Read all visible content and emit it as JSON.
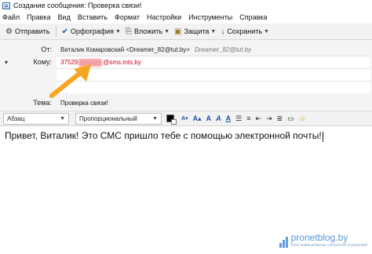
{
  "window": {
    "title": "Создание сообщения: Проверка связи!"
  },
  "menu": {
    "items": [
      "Файл",
      "Правка",
      "Вид",
      "Вставить",
      "Формат",
      "Настройки",
      "Инструменты",
      "Справка"
    ]
  },
  "toolbar": {
    "send": "Отправить",
    "spelling": "Орфография",
    "attach": "Вложить",
    "security": "Защита",
    "save": "Сохранить"
  },
  "headers": {
    "from_label": "От:",
    "from_name": "Виталик Комаровский <Dreamer_82@tut.by>",
    "from_alt": "Dreamer_82@tut.by",
    "to_label": "Кому:",
    "to_prefix": "37529",
    "to_suffix": "@sms.mts.by",
    "subject_label": "Тема:",
    "subject": "Проверка связи!"
  },
  "format": {
    "paragraph": "Абзац",
    "font": "Пропорциональный",
    "text_color": "#000000",
    "background_color": "#ffffff"
  },
  "message": {
    "body": "Привет, Виталик! Это СМС пришло тебе с помощью электронной почты!"
  },
  "watermark": {
    "name": "pronetblog.by",
    "tagline": "Блог компьютерных хитростей и решений"
  },
  "colors": {
    "arrow": "#f5a623",
    "recipient": "#d0021b",
    "link_blue": "#1f4fa3"
  }
}
